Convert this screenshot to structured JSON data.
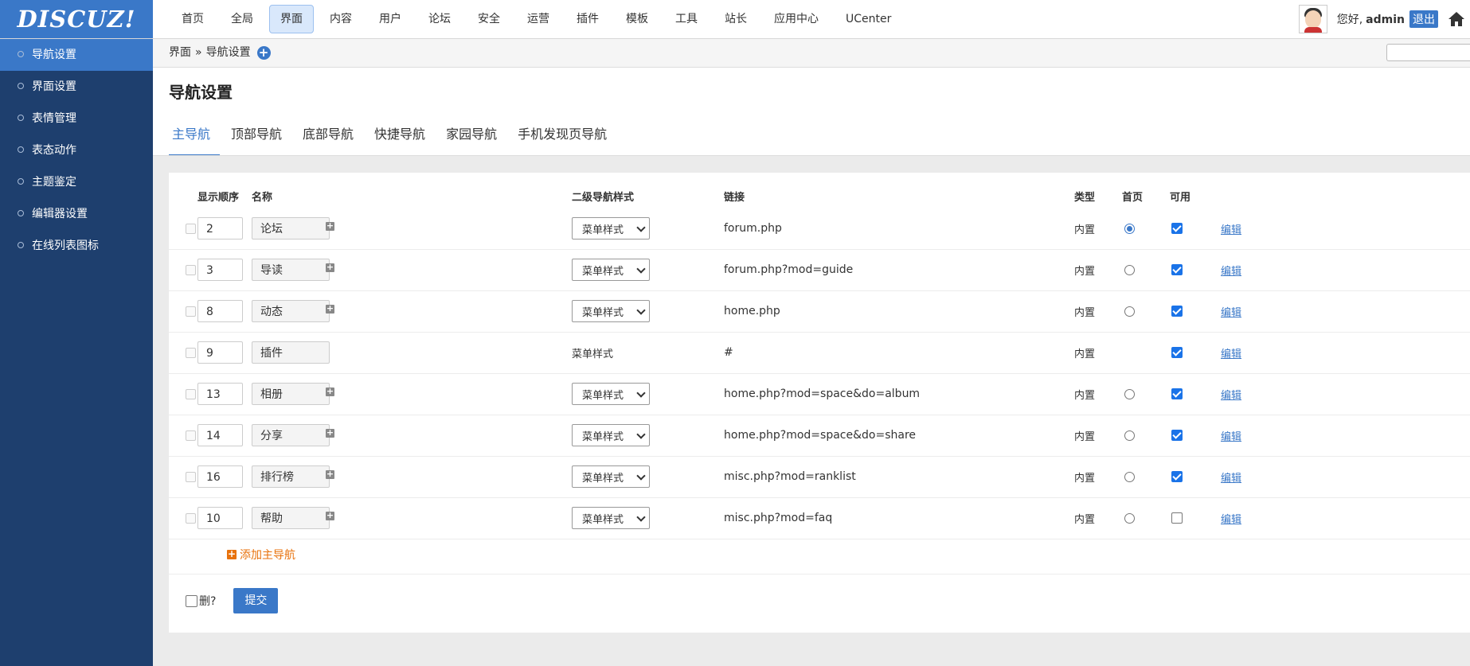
{
  "logo": "DISCUZ!",
  "top_nav": [
    "首页",
    "全局",
    "界面",
    "内容",
    "用户",
    "论坛",
    "安全",
    "运营",
    "插件",
    "模板",
    "工具",
    "站长",
    "应用中心",
    "UCenter"
  ],
  "top_nav_active": "界面",
  "user": {
    "greeting": "您好,",
    "name": "admin",
    "logout": "退出"
  },
  "icons": {
    "home": "home-icon",
    "add": "plus-circle-icon",
    "expand": "plus-square-icon",
    "radio": "radio-icon"
  },
  "sidebar": {
    "items": [
      "导航设置",
      "界面设置",
      "表情管理",
      "表态动作",
      "主题鉴定",
      "编辑器设置",
      "在线列表图标"
    ],
    "active": "导航设置"
  },
  "breadcrumb": {
    "parent": "界面",
    "separator": "»",
    "current": "导航设置"
  },
  "page_title": "导航设置",
  "tabs": [
    "主导航",
    "顶部导航",
    "底部导航",
    "快捷导航",
    "家园导航",
    "手机发现页导航"
  ],
  "active_tab": "主导航",
  "table": {
    "headers": {
      "order": "显示顺序",
      "name": "名称",
      "substyle": "二级导航样式",
      "link": "链接",
      "type": "类型",
      "home": "首页",
      "enabled": "可用"
    },
    "rows": [
      {
        "order": "2",
        "name": "论坛",
        "expandable": true,
        "substyle": "菜单样式",
        "substyle_select": true,
        "link": "forum.php",
        "type": "内置",
        "home": "checked",
        "enabled": true,
        "action": "编辑"
      },
      {
        "order": "3",
        "name": "导读",
        "expandable": true,
        "substyle": "菜单样式",
        "substyle_select": true,
        "link": "forum.php?mod=guide",
        "type": "内置",
        "home": "unchecked",
        "enabled": true,
        "action": "编辑"
      },
      {
        "order": "8",
        "name": "动态",
        "expandable": true,
        "substyle": "菜单样式",
        "substyle_select": true,
        "link": "home.php",
        "type": "内置",
        "home": "unchecked",
        "enabled": true,
        "action": "编辑"
      },
      {
        "order": "9",
        "name": "插件",
        "expandable": false,
        "substyle": "菜单样式",
        "substyle_select": false,
        "link": "#",
        "type": "内置",
        "home": "none",
        "enabled": true,
        "action": "编辑"
      },
      {
        "order": "13",
        "name": "相册",
        "expandable": true,
        "substyle": "菜单样式",
        "substyle_select": true,
        "link": "home.php?mod=space&do=album",
        "type": "内置",
        "home": "unchecked",
        "enabled": true,
        "action": "编辑"
      },
      {
        "order": "14",
        "name": "分享",
        "expandable": true,
        "substyle": "菜单样式",
        "substyle_select": true,
        "link": "home.php?mod=space&do=share",
        "type": "内置",
        "home": "unchecked",
        "enabled": true,
        "action": "编辑"
      },
      {
        "order": "16",
        "name": "排行榜",
        "expandable": true,
        "substyle": "菜单样式",
        "substyle_select": true,
        "link": "misc.php?mod=ranklist",
        "type": "内置",
        "home": "unchecked",
        "enabled": true,
        "action": "编辑"
      },
      {
        "order": "10",
        "name": "帮助",
        "expandable": true,
        "substyle": "菜单样式",
        "substyle_select": true,
        "link": "misc.php?mod=faq",
        "type": "内置",
        "home": "unchecked",
        "enabled": false,
        "action": "编辑"
      }
    ]
  },
  "add_main_nav": "添加主导航",
  "delete_label": "删?",
  "submit_label": "提交",
  "colors": {
    "accent": "#3a78c8",
    "sidebar_bg": "#1e3f6e",
    "orange": "#e8720c"
  }
}
